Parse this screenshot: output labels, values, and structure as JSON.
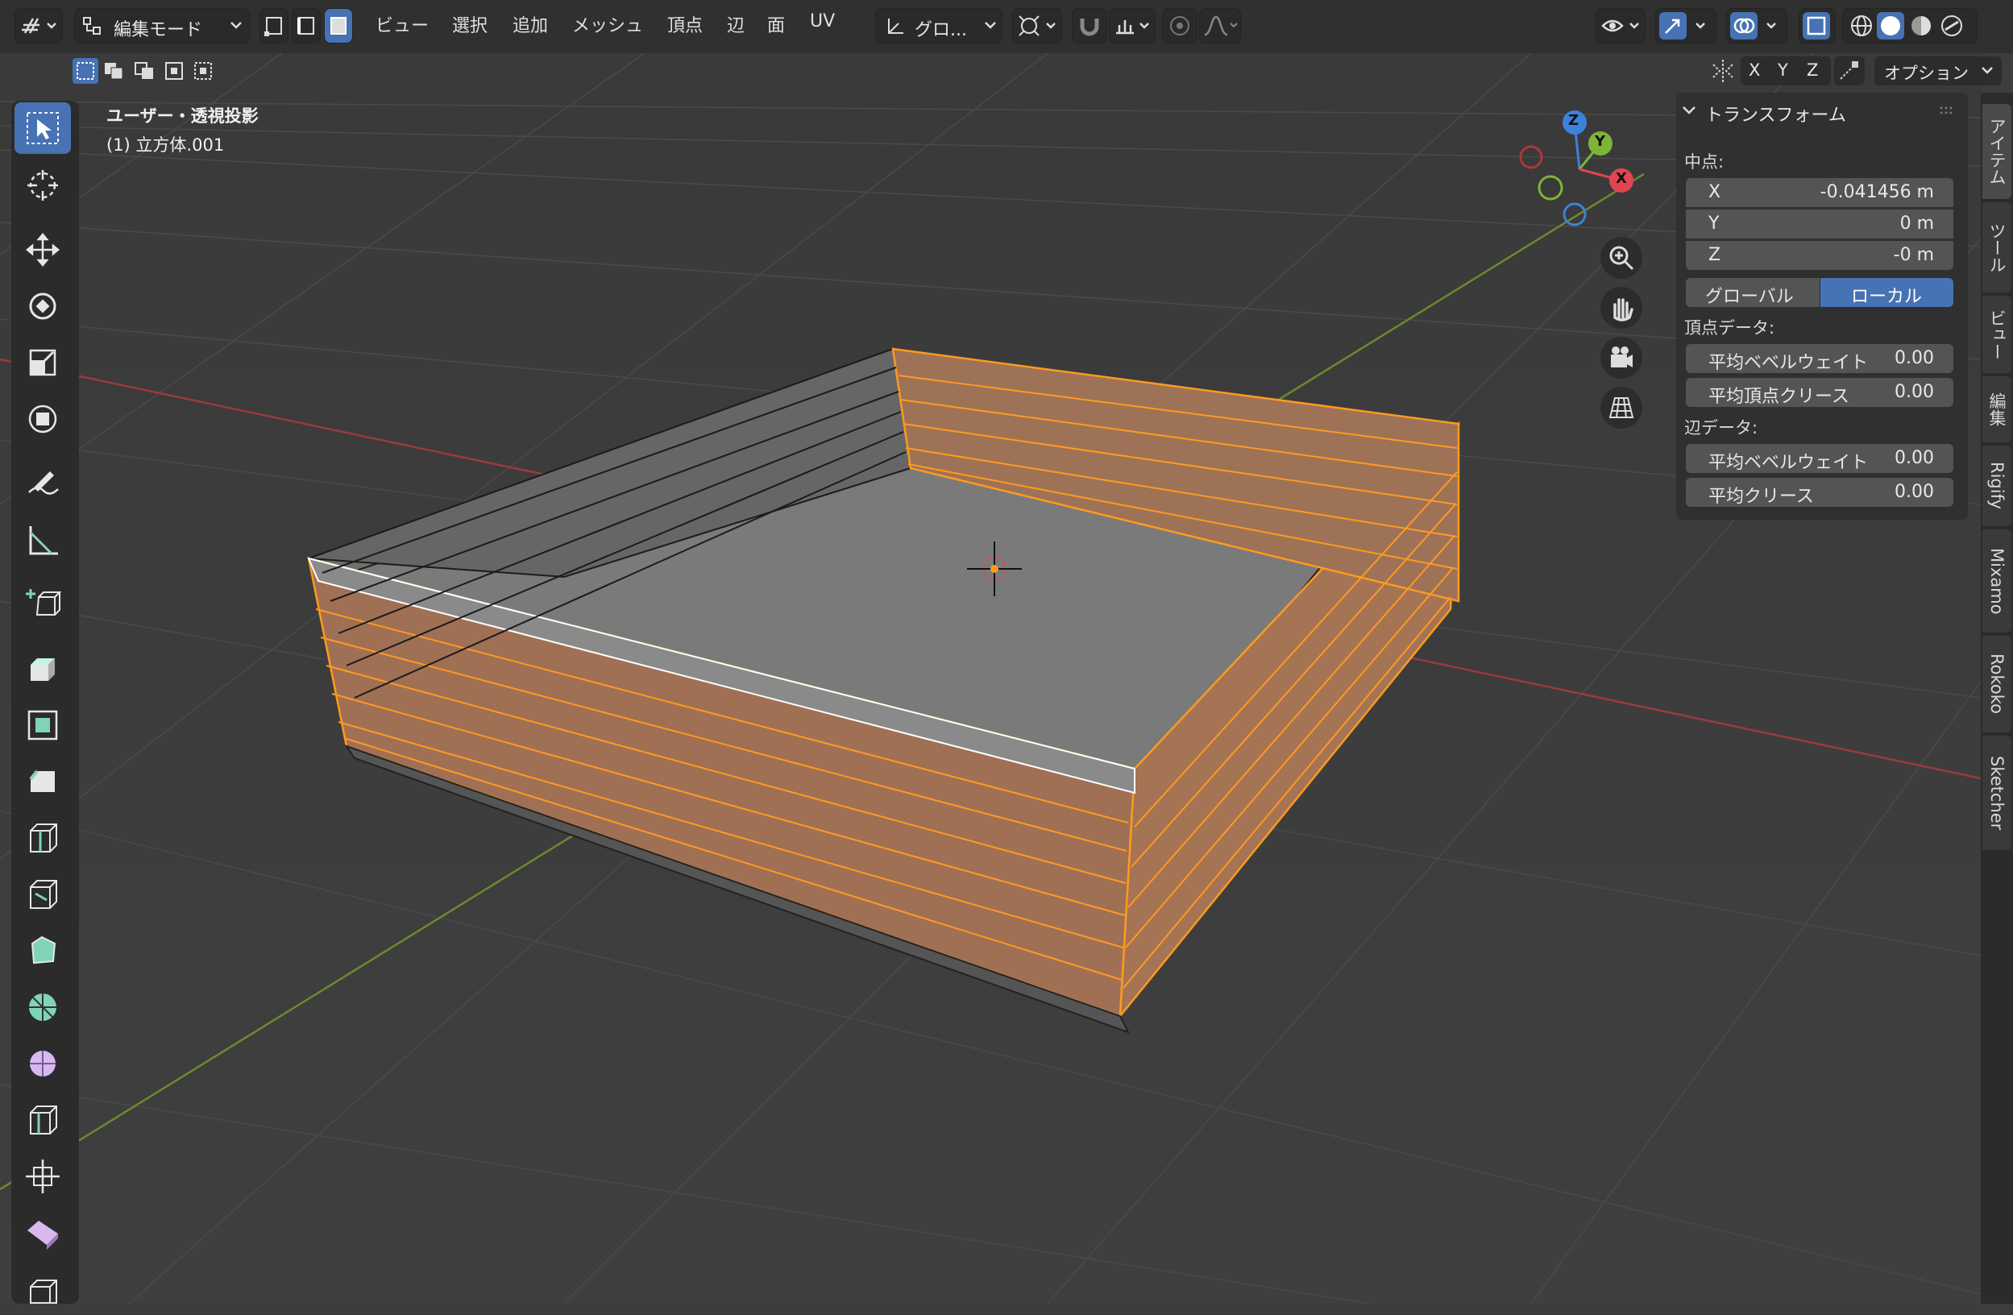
{
  "header": {
    "mode_label": "編集モード",
    "menus": [
      "ビュー",
      "選択",
      "追加",
      "メッシュ",
      "頂点",
      "辺",
      "面",
      "UV"
    ],
    "transform_orientation": "グロ...",
    "axis_x": "X",
    "axis_y": "Y",
    "axis_z": "Z",
    "options_label": "オプション"
  },
  "viewport": {
    "view_name": "ユーザー・透視投影",
    "object_name": "(1) 立方体.001"
  },
  "gizmo": {
    "x": "X",
    "y": "Y",
    "z": "Z"
  },
  "panel": {
    "title": "トランスフォーム",
    "median_label": "中点:",
    "coords": [
      {
        "axis": "X",
        "value": "-0.041456 m"
      },
      {
        "axis": "Y",
        "value": "0 m"
      },
      {
        "axis": "Z",
        "value": "-0 m"
      }
    ],
    "global_label": "グローバル",
    "local_label": "ローカル",
    "vertex_data_label": "頂点データ:",
    "vertex_fields": [
      {
        "label": "平均ベベルウェイト",
        "value": "0.00"
      },
      {
        "label": "平均頂点クリース",
        "value": "0.00"
      }
    ],
    "edge_data_label": "辺データ:",
    "edge_fields": [
      {
        "label": "平均ベベルウェイト",
        "value": "0.00"
      },
      {
        "label": "平均クリース",
        "value": "0.00"
      }
    ]
  },
  "side_tabs": [
    "アイテム",
    "ツール",
    "ビュー",
    "編集",
    "Rigify",
    "Mixamo",
    "Rokoko",
    "Sketcher"
  ],
  "colors": {
    "accent": "#4772b3",
    "selection_orange": "#ff9a1f",
    "x_axis": "#e24452",
    "y_axis": "#7fb437",
    "z_axis": "#3d82d9"
  }
}
